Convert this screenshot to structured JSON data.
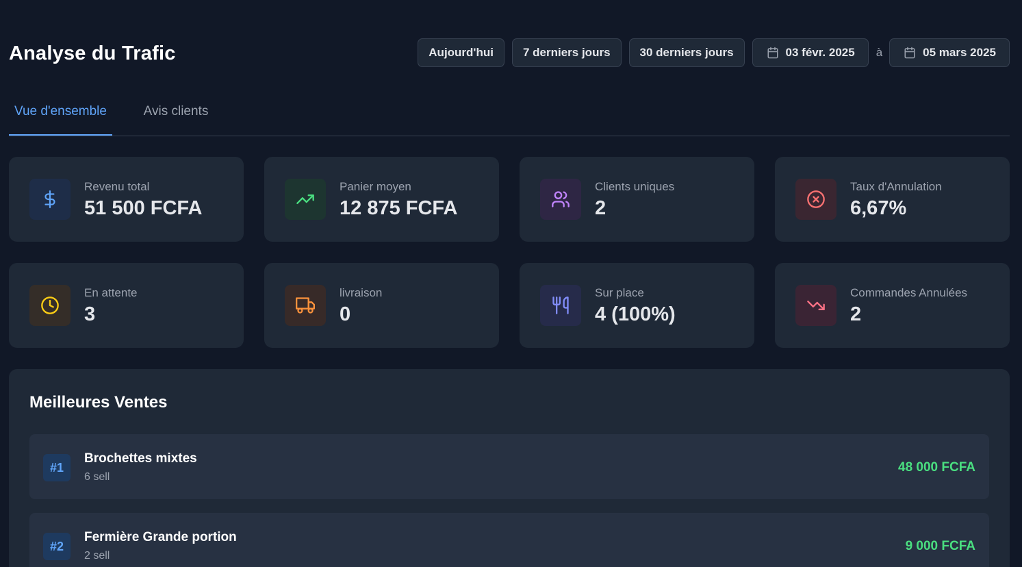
{
  "header": {
    "title": "Analyse du Trafic",
    "filters": {
      "today": "Aujourd'hui",
      "last7": "7 derniers jours",
      "last30": "30 derniers jours",
      "start_date": "03 févr. 2025",
      "separator": "à",
      "end_date": "05 mars 2025"
    }
  },
  "tabs": [
    {
      "label": "Vue d'ensemble",
      "active": true
    },
    {
      "label": "Avis clients",
      "active": false
    }
  ],
  "stats": [
    {
      "label": "Revenu total",
      "value": "51 500 FCFA",
      "icon": "dollar-icon",
      "color": "#60a5fa"
    },
    {
      "label": "Panier moyen",
      "value": "12 875 FCFA",
      "icon": "trending-up-icon",
      "color": "#4ade80"
    },
    {
      "label": "Clients uniques",
      "value": "2",
      "icon": "users-icon",
      "color": "#c084fc"
    },
    {
      "label": "Taux d'Annulation",
      "value": "6,67%",
      "icon": "x-circle-icon",
      "color": "#f87171"
    },
    {
      "label": "En attente",
      "value": "3",
      "icon": "clock-icon",
      "color": "#facc15"
    },
    {
      "label": "livraison",
      "value": "0",
      "icon": "truck-icon",
      "color": "#fb923c"
    },
    {
      "label": "Sur place",
      "value": "4 (100%)",
      "icon": "utensils-icon",
      "color": "#818cf8"
    },
    {
      "label": "Commandes Annulées",
      "value": "2",
      "icon": "trending-down-icon",
      "color": "#fb7185"
    }
  ],
  "best_sellers": {
    "title": "Meilleures Ventes",
    "items": [
      {
        "rank": "#1",
        "name": "Brochettes mixtes",
        "sold": "6 sell",
        "amount": "48 000 FCFA"
      },
      {
        "rank": "#2",
        "name": "Fermière Grande portion",
        "sold": "2 sell",
        "amount": "9 000 FCFA"
      }
    ]
  }
}
